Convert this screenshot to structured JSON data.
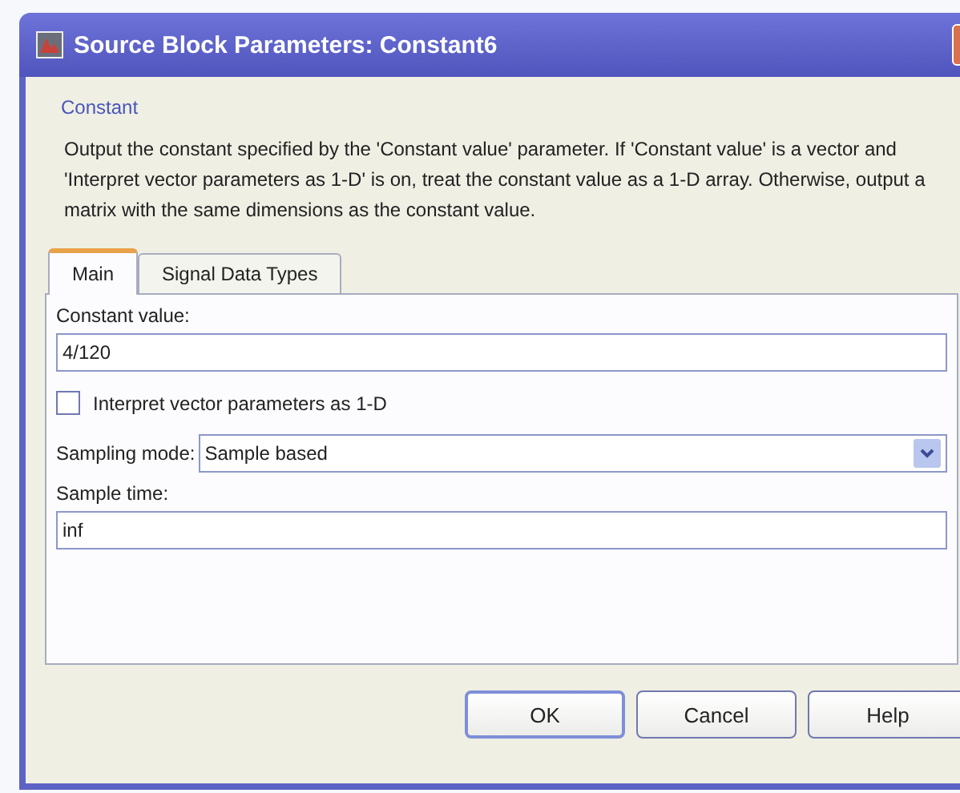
{
  "window": {
    "title": "Source Block Parameters: Constant6"
  },
  "block_type": "Constant",
  "description": "Output the constant specified by the 'Constant value' parameter. If 'Constant value' is a vector and 'Interpret vector parameters as 1-D' is on, treat the constant value as a 1-D array. Otherwise, output a matrix with the same dimensions as the constant value.",
  "tabs": [
    {
      "label": "Main",
      "selected": true
    },
    {
      "label": "Signal Data Types",
      "selected": false
    }
  ],
  "fields": [
    {
      "kind": "text",
      "label": "Constant value:",
      "value": "4/120"
    },
    {
      "kind": "checkbox",
      "label": "Interpret vector parameters as 1-D",
      "checked": false
    },
    {
      "kind": "dropdown",
      "label": "Sampling mode:",
      "value": "Sample based"
    },
    {
      "kind": "text",
      "label": "Sample time:",
      "value": "inf"
    }
  ],
  "buttons": [
    {
      "label": "OK",
      "default": true
    },
    {
      "label": "Cancel",
      "default": false
    },
    {
      "label": "Help",
      "default": false
    }
  ]
}
